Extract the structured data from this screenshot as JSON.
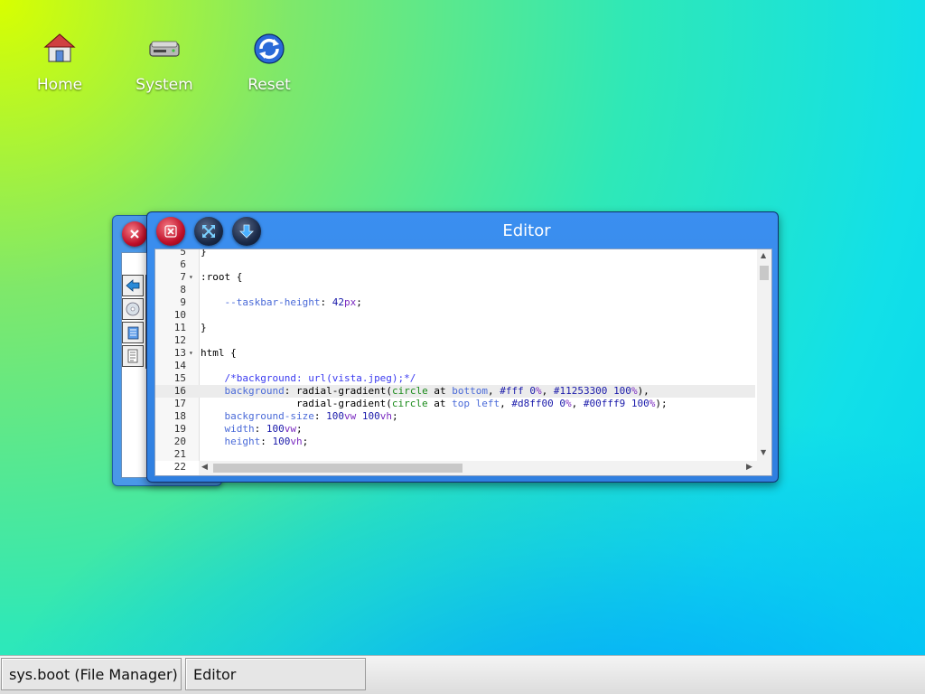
{
  "desktop": {
    "icons": [
      {
        "label": "Home",
        "icon": "home-icon"
      },
      {
        "label": "System",
        "icon": "drive-icon"
      },
      {
        "label": "Reset",
        "icon": "refresh-icon"
      }
    ]
  },
  "editor_window": {
    "title": "Editor",
    "code_lines": [
      {
        "n": "5",
        "text": "}"
      },
      {
        "n": "6",
        "text": ""
      },
      {
        "n": "7",
        "text": ":root {",
        "fold": true
      },
      {
        "n": "8",
        "text": ""
      },
      {
        "n": "9",
        "text": "    --taskbar-height: 42px;"
      },
      {
        "n": "10",
        "text": ""
      },
      {
        "n": "11",
        "text": "}"
      },
      {
        "n": "12",
        "text": ""
      },
      {
        "n": "13",
        "text": "html {",
        "fold": true
      },
      {
        "n": "14",
        "text": ""
      },
      {
        "n": "15",
        "text": "    /*background: url(vista.jpeg);*/"
      },
      {
        "n": "16",
        "text": "    background: radial-gradient(circle at bottom, #fff 0%, #11253300 100%),",
        "active": true
      },
      {
        "n": "17",
        "text": "                radial-gradient(circle at top left, #d8ff00 0%, #00fff9 100%);"
      },
      {
        "n": "18",
        "text": "    background-size: 100vw 100vh;"
      },
      {
        "n": "19",
        "text": "    width: 100vw;"
      },
      {
        "n": "20",
        "text": "    height: 100vh;"
      },
      {
        "n": "21",
        "text": ""
      },
      {
        "n": "22",
        "text": ""
      }
    ]
  },
  "taskbar": {
    "items": [
      {
        "label": "sys.boot (File Manager)"
      },
      {
        "label": "Editor"
      }
    ]
  },
  "colors": {
    "window_blue": "#3b8ff0",
    "close_red": "#c0102a",
    "taskbar_bg": "#e6e6e6"
  }
}
